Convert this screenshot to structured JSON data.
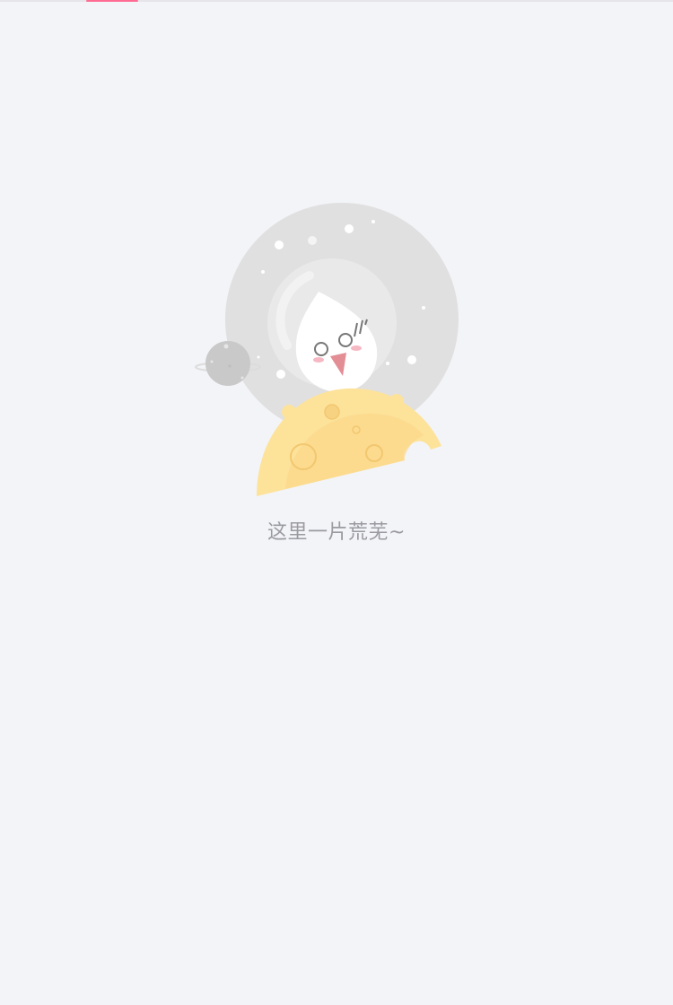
{
  "tab_indicator": {
    "active_color": "#ff6b93"
  },
  "empty_state": {
    "message": "这里一片荒芜~",
    "illustration_icon": "astronaut-on-moon-empty-icon"
  },
  "colors": {
    "background": "#f3f4f8",
    "text": "#9a9aa0",
    "moon": "#fde29a",
    "helmet": "#e2e2e2"
  }
}
